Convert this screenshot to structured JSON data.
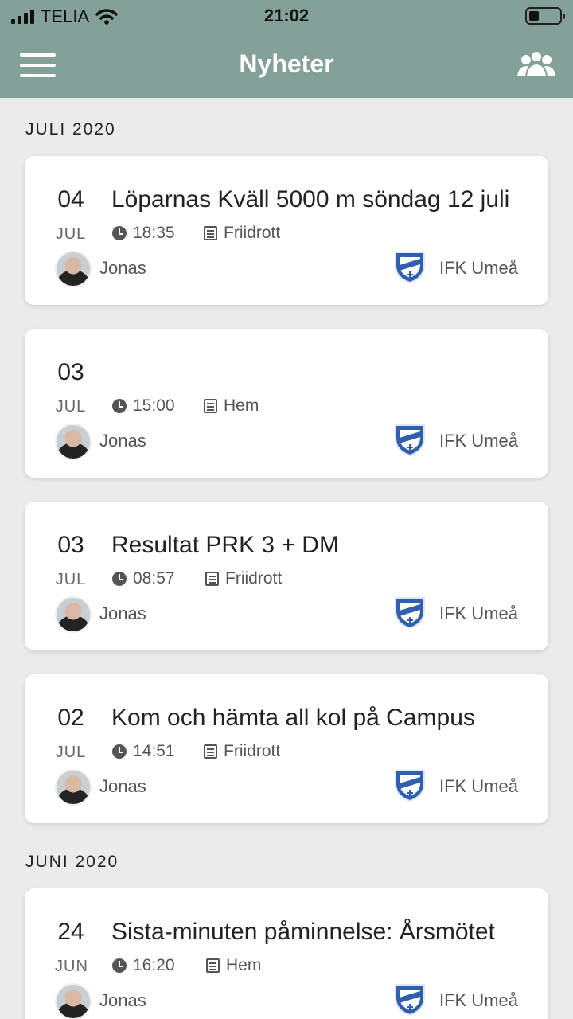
{
  "status_bar": {
    "carrier": "TELIA",
    "time": "21:02"
  },
  "nav": {
    "title": "Nyheter",
    "menu_icon": "hamburger-icon",
    "right_icon": "group-users-icon"
  },
  "sections": [
    {
      "title": "JULI 2020",
      "items": [
        {
          "day": "04",
          "month": "JUL",
          "headline": "Löparnas Kväll 5000 m söndag 12 juli",
          "time": "18:35",
          "category": "Friidrott",
          "author": "Jonas",
          "club": "IFK Umeå"
        },
        {
          "day": "03",
          "month": "JUL",
          "headline": "",
          "time": "15:00",
          "category": "Hem",
          "author": "Jonas",
          "club": "IFK Umeå"
        },
        {
          "day": "03",
          "month": "JUL",
          "headline": "Resultat PRK 3 + DM",
          "time": "08:57",
          "category": "Friidrott",
          "author": "Jonas",
          "club": "IFK Umeå"
        },
        {
          "day": "02",
          "month": "JUL",
          "headline": "Kom och hämta all kol på Campus",
          "time": "14:51",
          "category": "Friidrott",
          "author": "Jonas",
          "club": "IFK Umeå"
        }
      ]
    },
    {
      "title": "JUNI 2020",
      "items": [
        {
          "day": "24",
          "month": "JUN",
          "headline": "Sista-minuten påminnelse: Årsmötet",
          "time": "16:20",
          "category": "Hem",
          "author": "Jonas",
          "club": "IFK Umeå"
        }
      ]
    }
  ],
  "colors": {
    "header": "#84a199",
    "background": "#ebebeb",
    "card": "#ffffff",
    "club_logo": "#2f5fae"
  }
}
